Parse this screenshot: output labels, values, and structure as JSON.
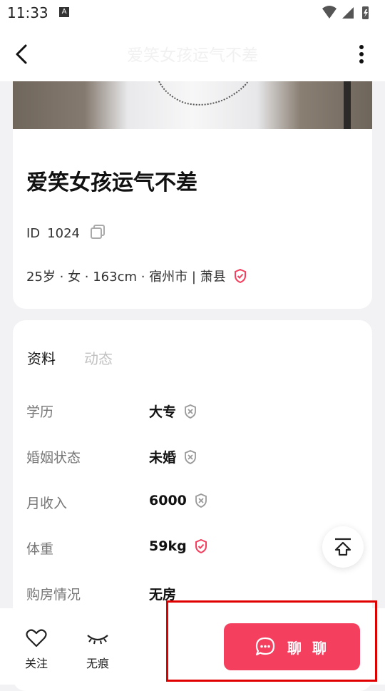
{
  "status_bar": {
    "time": "11:33",
    "notification_icon": "A"
  },
  "nav": {
    "title": "爱笑女孩运气不差",
    "back_icon": "chevron-left-icon",
    "more_icon": "more-vertical-icon"
  },
  "profile": {
    "name": "爱笑女孩运气不差",
    "id_label": "ID",
    "id_value": "1024",
    "meta": "25岁 · 女 · 163cm · 宿州市 | 萧县"
  },
  "tabs": [
    {
      "label": "资料",
      "active": true
    },
    {
      "label": "动态",
      "active": false
    }
  ],
  "fields": [
    {
      "label": "学历",
      "value": "大专",
      "verified": false
    },
    {
      "label": "婚姻状态",
      "value": "未婚",
      "verified": false
    },
    {
      "label": "月收入",
      "value": "6000",
      "verified": false
    },
    {
      "label": "体重",
      "value": "59kg",
      "verified": true
    },
    {
      "label": "购房情况",
      "value": "无房",
      "verified": false
    }
  ],
  "bottom_bar": {
    "follow_label": "关注",
    "traceless_label": "无痕",
    "chat_label": "聊 聊"
  },
  "colors": {
    "accent": "#f43f5e",
    "verified": "#f43f5e",
    "unverified": "#9a9a9a",
    "highlight": "#e00000"
  }
}
